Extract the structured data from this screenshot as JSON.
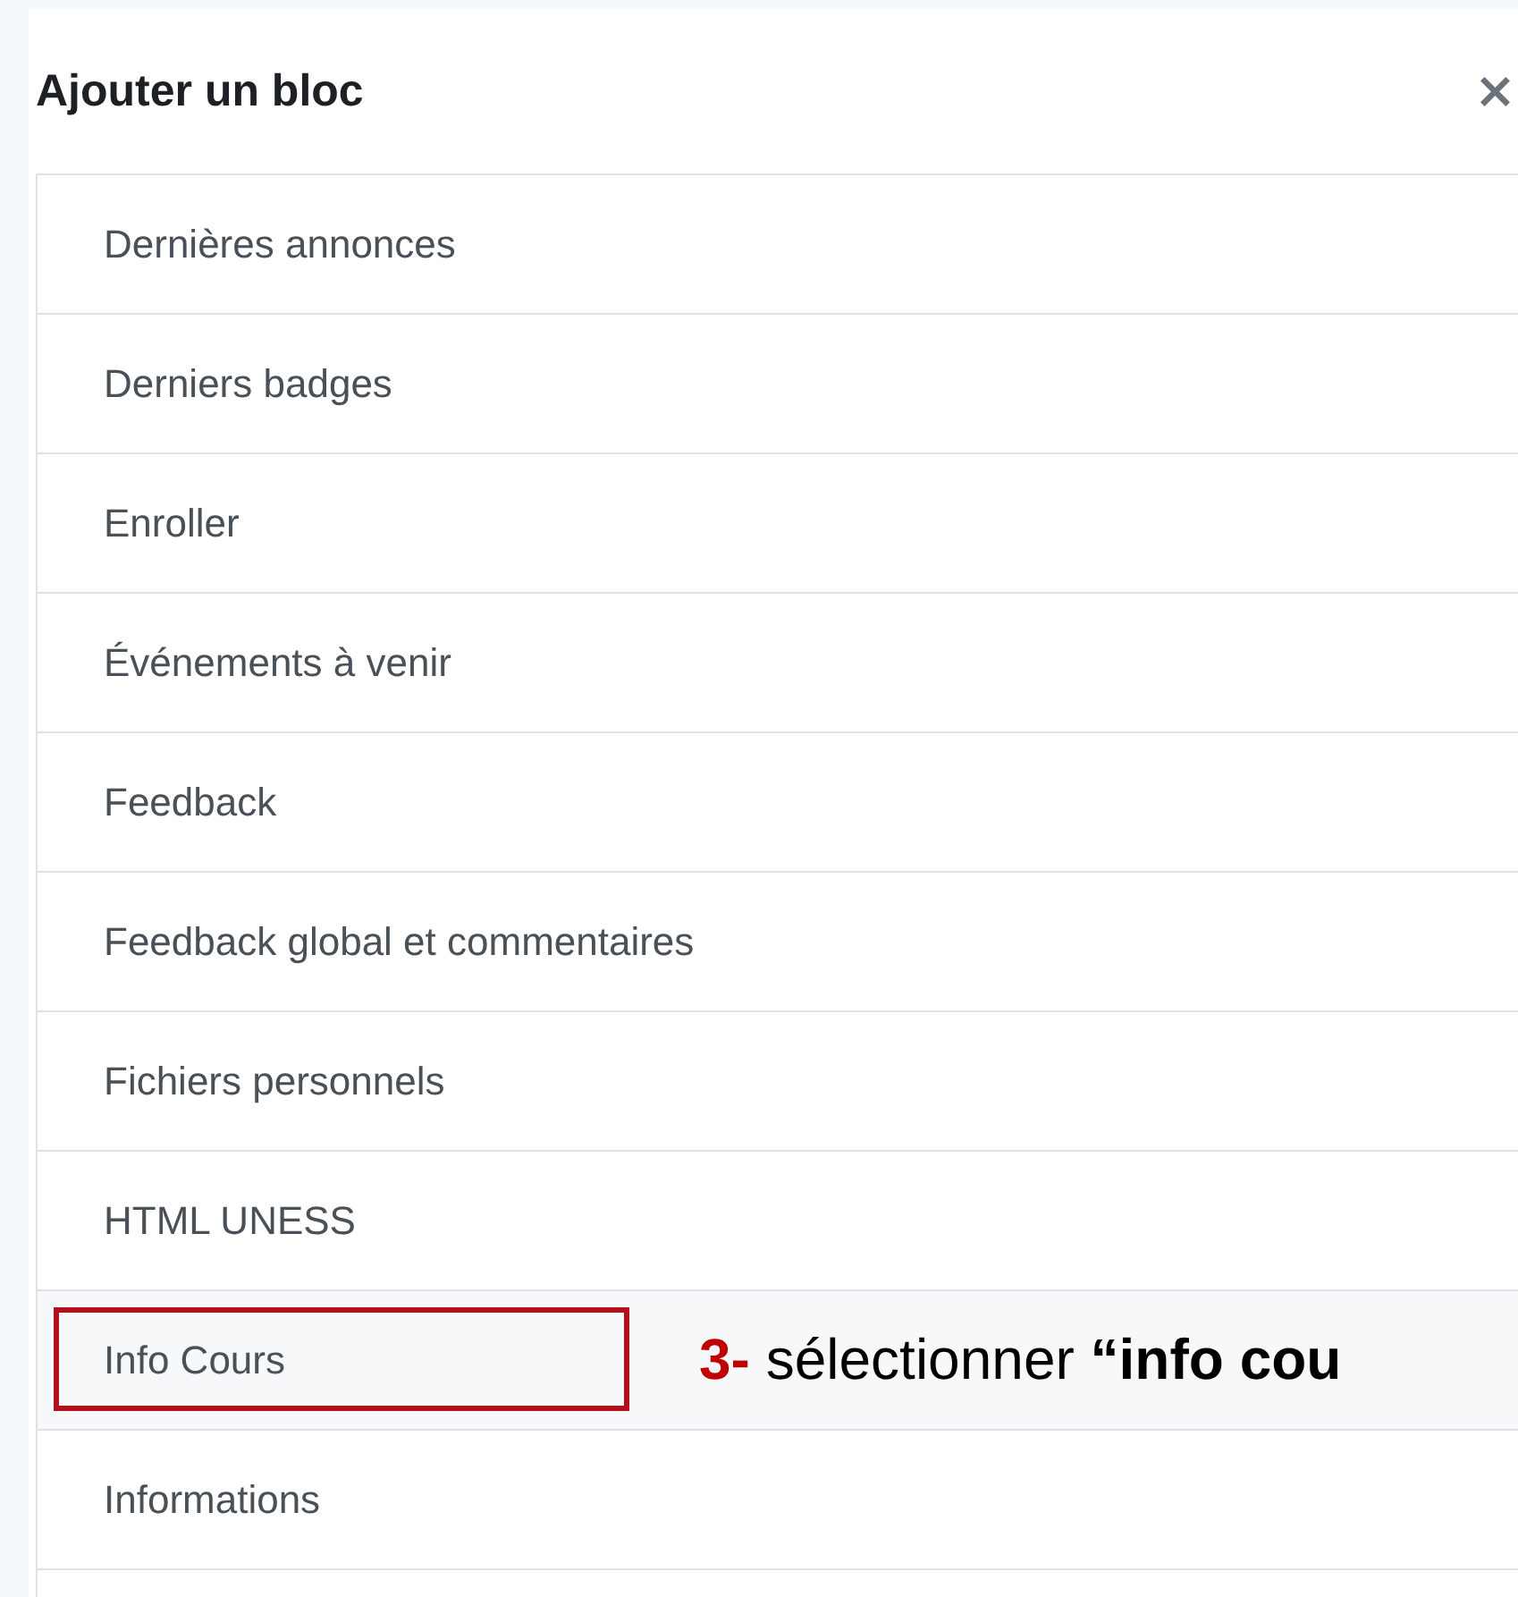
{
  "dialog": {
    "title": "Ajouter un bloc",
    "close": "×"
  },
  "items": [
    {
      "label": "Dernières annonces",
      "selected": false
    },
    {
      "label": "Derniers badges",
      "selected": false
    },
    {
      "label": "Enroller",
      "selected": false
    },
    {
      "label": "Événements à venir",
      "selected": false
    },
    {
      "label": "Feedback",
      "selected": false
    },
    {
      "label": "Feedback global et commentaires",
      "selected": false
    },
    {
      "label": "Fichiers personnels",
      "selected": false
    },
    {
      "label": "HTML UNESS",
      "selected": false
    },
    {
      "label": "Info Cours",
      "selected": true
    },
    {
      "label": "Informations",
      "selected": false
    }
  ],
  "annotation": {
    "step": "3-",
    "text": "sélectionner **“info cou**"
  }
}
